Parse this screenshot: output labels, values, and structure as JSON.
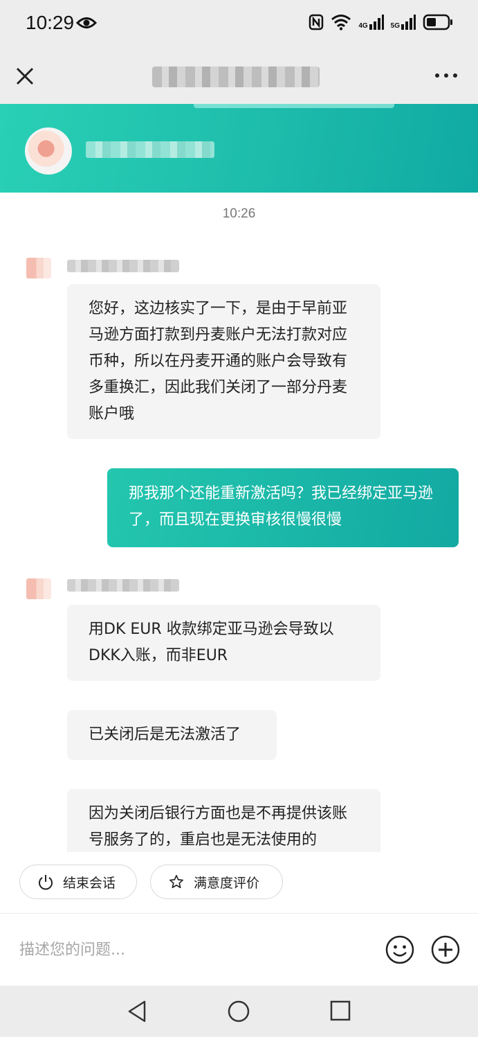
{
  "status_bar": {
    "time": "10:29",
    "net1": "4G",
    "net2": "5G",
    "icons": [
      "eye-icon",
      "nfc-icon",
      "wifi-icon",
      "signal-icon",
      "battery-icon"
    ]
  },
  "header": {
    "close_icon": "close-icon",
    "more_icon": "more-icon"
  },
  "chat": {
    "timestamp": "10:26",
    "messages": [
      {
        "from": "agent",
        "text": "您好，这边核实了一下，是由于早前亚马逊方面打款到丹麦账户无法打款对应币种，所以在丹麦开通的账户会导致有多重换汇，因此我们关闭了一部分丹麦账户哦"
      },
      {
        "from": "user",
        "text": "那我那个还能重新激活吗？我已经绑定亚马逊了，而且现在更换审核很慢很慢"
      },
      {
        "from": "agent",
        "text": "用DK EUR 收款绑定亚马逊会导致以DKK入账，而非EUR"
      },
      {
        "from": "agent",
        "text": "已关闭后是无法激活了"
      },
      {
        "from": "agent",
        "text": "因为关闭后银行方面也是不再提供该账号服务了的，重启也是无法使用的"
      }
    ]
  },
  "quick_actions": {
    "end_session": "结束会话",
    "rate": "满意度评价"
  },
  "input": {
    "placeholder": "描述您的问题...",
    "value": ""
  },
  "colors": {
    "accent": "#1fbfad",
    "bubble_in": "#f4f4f4",
    "bar_bg": "#ededed"
  }
}
